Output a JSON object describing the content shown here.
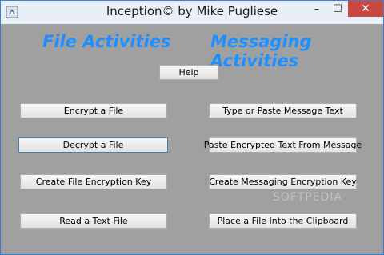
{
  "window": {
    "title": "Inception© by Mike Pugliese",
    "minimize": "–",
    "maximize": "☐",
    "close": "✕"
  },
  "headings": {
    "file": "File Activities",
    "messaging": "Messaging Activities"
  },
  "buttons": {
    "help": "Help",
    "encrypt_file": "Encrypt a File",
    "decrypt_file": "Decrypt a File",
    "create_file_key": "Create File Encryption Key",
    "read_text_file": "Read a Text File",
    "type_message": "Type or Paste Message Text",
    "paste_encrypted": "Paste Encrypted Text From Message",
    "create_msg_key": "Create Messaging Encryption Key",
    "place_clipboard": "Place a File Into the Clipboard"
  },
  "watermark": {
    "brand": "SOFTPEDIA",
    "url": "www.softpedia.com"
  },
  "colors": {
    "heading": "#1f8fff",
    "background": "#a0a0a0"
  },
  "icons": {
    "app": "app-icon"
  }
}
